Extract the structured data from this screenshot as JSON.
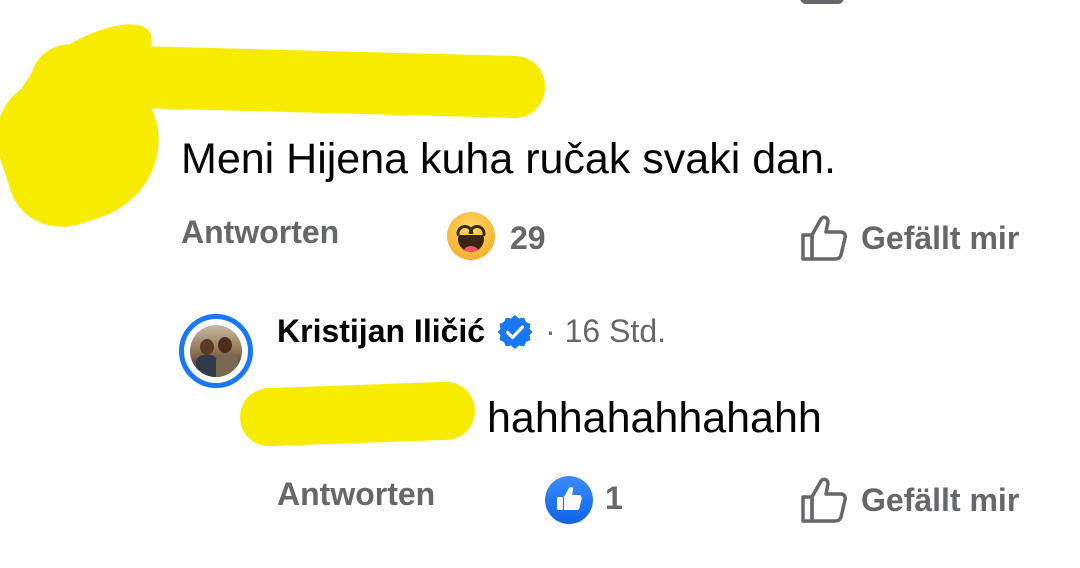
{
  "comment": {
    "text": "Meni Hijena kuha ručak svaki dan.",
    "reply_label": "Antworten",
    "reaction_icon": "haha-emoji-icon",
    "reaction_count": "29",
    "like_label": "Gefällt mir"
  },
  "reply": {
    "author": "Kristijan Iličić",
    "verified_icon": "verified-badge-icon",
    "meta": "· 16 Std.",
    "text": "hahhahahhahahh",
    "reply_label": "Antworten",
    "reaction_icon": "like-reaction-icon",
    "reaction_count": "1",
    "like_label": "Gefällt mir"
  },
  "colors": {
    "accent": "#1877f2",
    "secondary_text": "#65676b",
    "redaction": "#f7ec00"
  }
}
